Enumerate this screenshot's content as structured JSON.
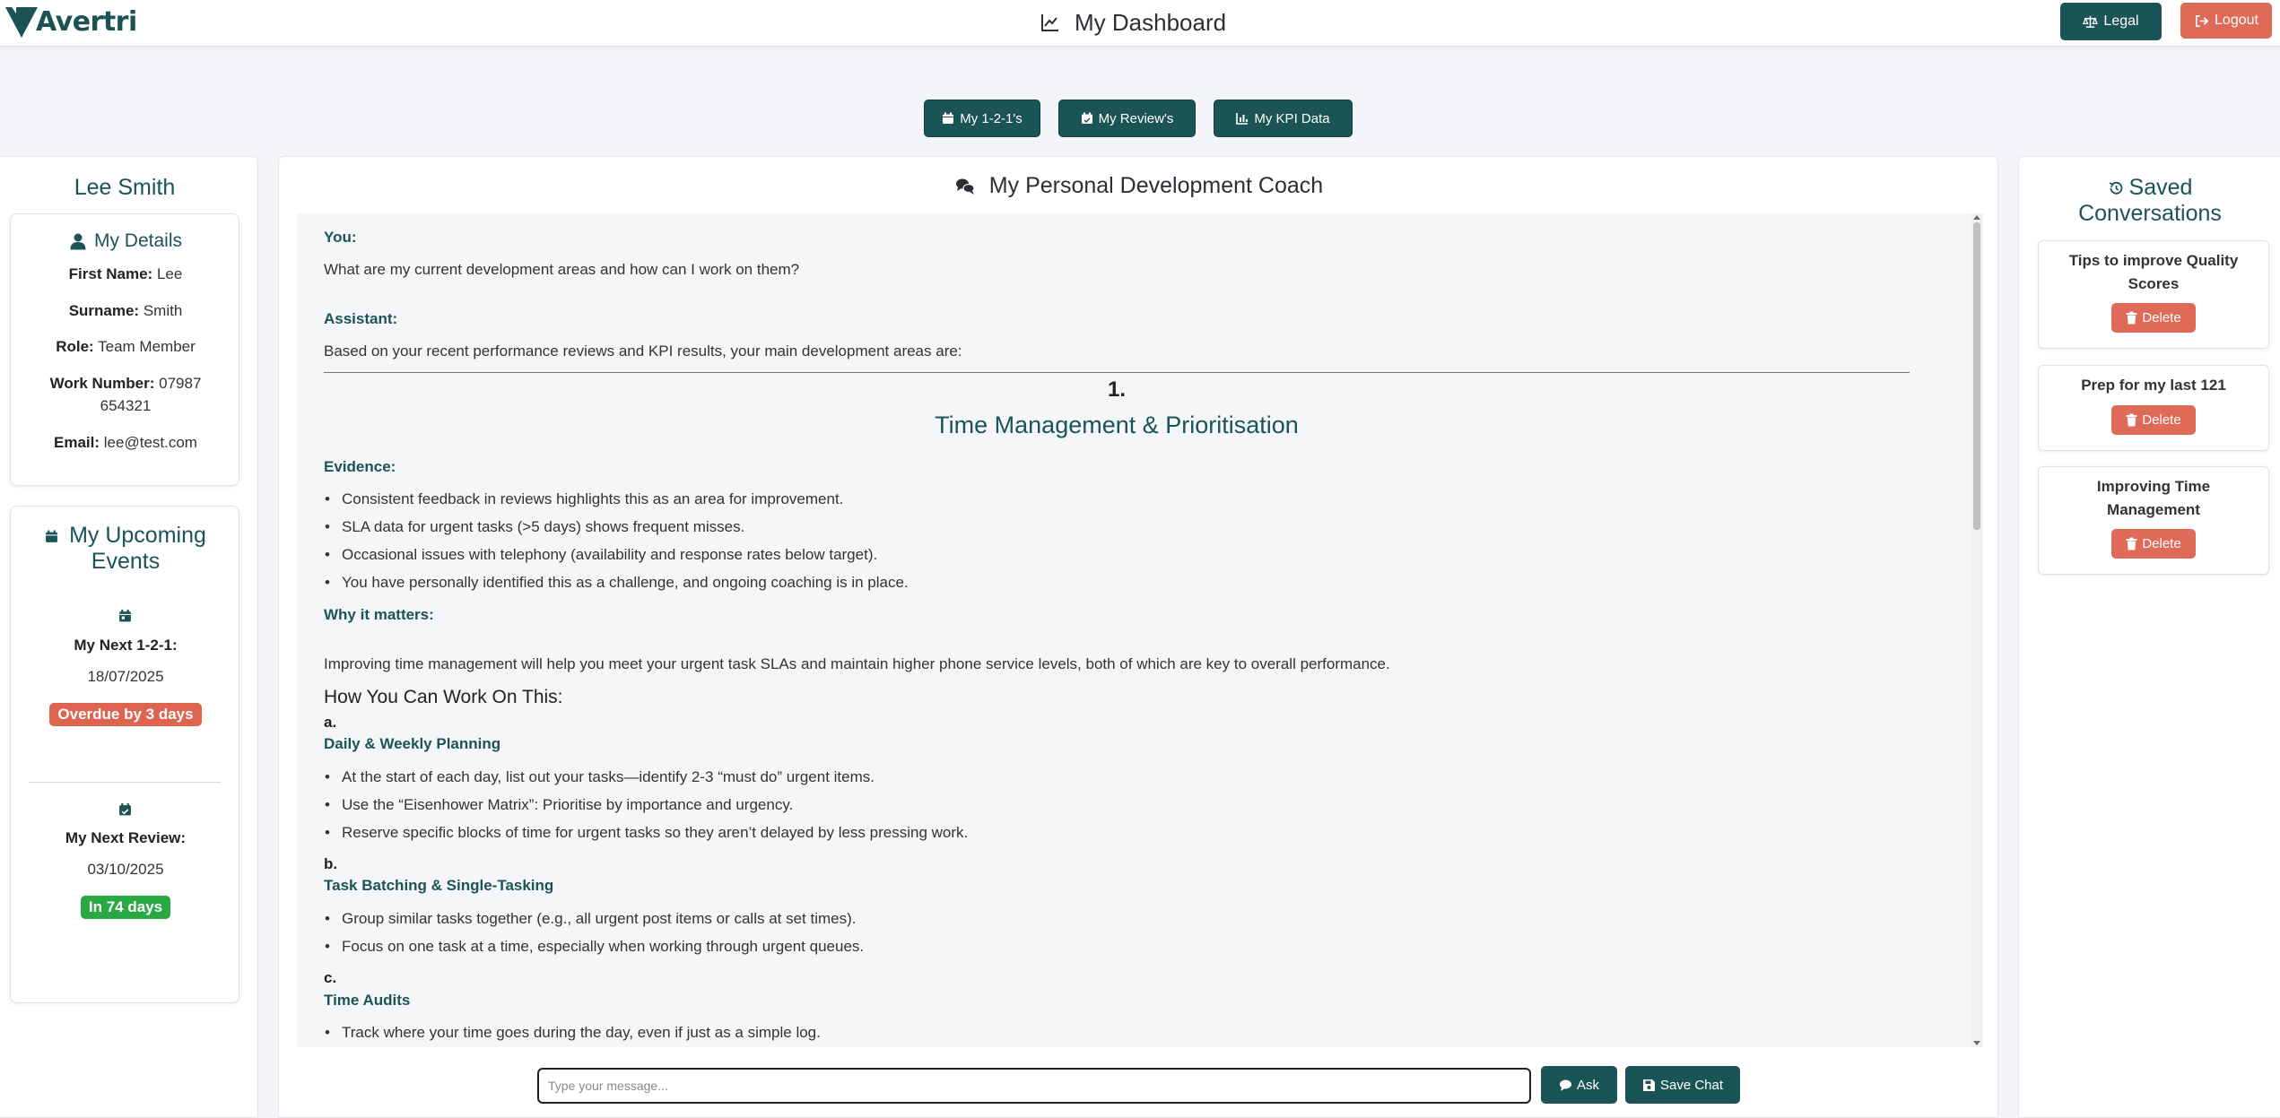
{
  "header": {
    "brand": "Avertri",
    "title": "My Dashboard",
    "legal_label": "Legal",
    "logout_label": "Logout"
  },
  "nav": {
    "one_to_ones": "My 1-2-1's",
    "reviews": "My Review's",
    "kpi": "My KPI Data"
  },
  "profile": {
    "name": "Lee Smith",
    "details_heading": "My Details",
    "first_name_label": "First Name:",
    "first_name": "Lee",
    "surname_label": "Surname:",
    "surname": "Smith",
    "role_label": "Role:",
    "role": "Team Member",
    "work_number_label": "Work Number:",
    "work_number_line1": "07987",
    "work_number_line2": "654321",
    "email_label": "Email:",
    "email": "lee@test.com"
  },
  "events": {
    "heading_line1": "My Upcoming",
    "heading_line2": "Events",
    "next_121_label": "My Next 1-2-1:",
    "next_121_date": "18/07/2025",
    "next_121_status": "Overdue by 3 days",
    "next_review_label": "My Next Review:",
    "next_review_date": "03/10/2025",
    "next_review_status": "In 74 days"
  },
  "coach": {
    "title": "My Personal Development Coach",
    "you_label": "You:",
    "question": "What are my current development areas and how can I work on them?",
    "assistant_label": "Assistant:",
    "intro": "Based on your recent performance reviews and KPI results, your main development areas are:",
    "item_number": "1.",
    "item_title": "Time Management & Prioritisation",
    "evidence_label": "Evidence:",
    "evidence": [
      "Consistent feedback in reviews highlights this as an area for improvement.",
      "SLA data for urgent tasks (>5 days) shows frequent misses.",
      "Occasional issues with telephony (availability and response rates below target).",
      "You have personally identified this as a challenge, and ongoing coaching is in place."
    ],
    "why_label": "Why it matters:",
    "why_text": "Improving time management will help you meet your urgent task SLAs and maintain higher phone service levels, both of which are key to overall performance.",
    "how_heading": "How You Can Work On This:",
    "a_letter": "a.",
    "a_title": "Daily & Weekly Planning",
    "a_items": [
      "At the start of each day, list out your tasks—identify 2-3 “must do” urgent items.",
      "Use the “Eisenhower Matrix”: Prioritise by importance and urgency.",
      "Reserve specific blocks of time for urgent tasks so they aren’t delayed by less pressing work."
    ],
    "b_letter": "b.",
    "b_title": "Task Batching & Single-Tasking",
    "b_items": [
      "Group similar tasks together (e.g., all urgent post items or calls at set times).",
      "Focus on one task at a time, especially when working through urgent queues."
    ],
    "c_letter": "c.",
    "c_title": "Time Audits",
    "c_items": [
      "Track where your time goes during the day, even if just as a simple log."
    ],
    "input_placeholder": "Type your message...",
    "ask_label": "Ask",
    "save_label": "Save Chat"
  },
  "saved": {
    "heading_line1": "Saved",
    "heading_line2": "Conversations",
    "delete_label": "Delete",
    "conv1_line1": "Tips to improve Quality",
    "conv1_line2": "Scores",
    "conv2_line1": "Prep for my last 121",
    "conv3_line1": "Improving Time",
    "conv3_line2": "Management"
  },
  "colors": {
    "primary": "#1b5457",
    "danger": "#de6a57",
    "success": "#2aa843",
    "background": "#f3f5f8"
  }
}
